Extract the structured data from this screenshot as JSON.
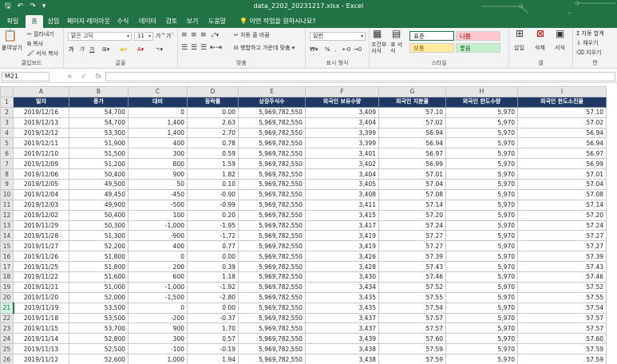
{
  "window": {
    "title": "data_2202_20231217.xlsx  -  Excel"
  },
  "qat": {
    "save_icon": "save-icon",
    "undo_icon": "undo-icon",
    "redo_icon": "redo-icon"
  },
  "tabs": [
    {
      "label": "파일"
    },
    {
      "label": "홈"
    },
    {
      "label": "삽입"
    },
    {
      "label": "페이지 레이아웃"
    },
    {
      "label": "수식"
    },
    {
      "label": "데이터"
    },
    {
      "label": "검토"
    },
    {
      "label": "보기"
    },
    {
      "label": "도움말"
    }
  ],
  "active_tab": "홈",
  "tell_me": "어떤 작업을 원하시나요?",
  "ribbon": {
    "clipboard": {
      "paste": "붙여넣기",
      "cut": "잘라내기",
      "copy": "복사",
      "format_painter": "서식 복사",
      "label": "클립보드"
    },
    "font": {
      "name": "맑은 고딕",
      "size": "11",
      "bold": "가",
      "italic": "가",
      "underline": "가",
      "grow": "가^",
      "shrink": "가ˇ",
      "label": "글꼴"
    },
    "align": {
      "wrap": "자동 줄 바꿈",
      "merge": "병합하고 가운데 맞춤",
      "label": "맞춤"
    },
    "number": {
      "format": "일반",
      "percent": "%",
      "comma": ",",
      "label": "표시 형식"
    },
    "styles": {
      "cond": "조건부 서식",
      "table": "표 서식",
      "normal": "표준",
      "bad": "나쁨",
      "good_text": "보통",
      "neutral": "좋음",
      "label": "스타일"
    },
    "cells": {
      "insert": "삽입",
      "delete": "삭제",
      "format": "서식",
      "label": "셀"
    },
    "editing": {
      "autosum": "Σ 자동 합계",
      "fill": "채우기",
      "clear": "지우기",
      "label": "편"
    }
  },
  "formula_bar": {
    "name_box": "M21",
    "cancel": "×",
    "enter": "✓",
    "fx": "fx",
    "value": ""
  },
  "sheet": {
    "columns": [
      "A",
      "B",
      "C",
      "D",
      "E",
      "F",
      "G",
      "H",
      "I"
    ],
    "headers": [
      "일자",
      "종가",
      "대비",
      "등락률",
      "상장주식수",
      "외국인 보유수량",
      "외국인 지분율",
      "외국인 한도수량",
      "외국인 한도소진율"
    ],
    "selected_row": 21,
    "rows": [
      [
        "2019/12/16",
        "54,700",
        "0",
        "0.00",
        "5,969,782,550",
        "3,409",
        "57.10",
        "5,970",
        "57.10"
      ],
      [
        "2019/12/13",
        "54,700",
        "1,400",
        "2.63",
        "5,969,782,550",
        "3,404",
        "57.02",
        "5,970",
        "57.02"
      ],
      [
        "2019/12/12",
        "53,300",
        "1,400",
        "2.70",
        "5,969,782,550",
        "3,399",
        "56.94",
        "5,970",
        "56.94"
      ],
      [
        "2019/12/11",
        "51,900",
        "400",
        "0.78",
        "5,969,782,550",
        "3,399",
        "56.94",
        "5,970",
        "56.94"
      ],
      [
        "2019/12/10",
        "51,500",
        "300",
        "0.59",
        "5,969,782,550",
        "3,401",
        "56.97",
        "5,970",
        "56.97"
      ],
      [
        "2019/12/09",
        "51,200",
        "800",
        "1.59",
        "5,969,782,550",
        "3,402",
        "56.99",
        "5,970",
        "56.99"
      ],
      [
        "2019/12/06",
        "50,400",
        "900",
        "1.82",
        "5,969,782,550",
        "3,404",
        "57.01",
        "5,970",
        "57.01"
      ],
      [
        "2019/12/05",
        "49,500",
        "50",
        "0.10",
        "5,969,782,550",
        "3,405",
        "57.04",
        "5,970",
        "57.04"
      ],
      [
        "2019/12/04",
        "49,450",
        "-450",
        "-0.90",
        "5,969,782,550",
        "3,408",
        "57.08",
        "5,970",
        "57.08"
      ],
      [
        "2019/12/03",
        "49,900",
        "-500",
        "-0.99",
        "5,969,782,550",
        "3,411",
        "57.14",
        "5,970",
        "57.14"
      ],
      [
        "2019/12/02",
        "50,400",
        "100",
        "0.20",
        "5,969,782,550",
        "3,415",
        "57.20",
        "5,970",
        "57.20"
      ],
      [
        "2019/11/29",
        "50,300",
        "-1,000",
        "-1.95",
        "5,969,782,550",
        "3,417",
        "57.24",
        "5,970",
        "57.24"
      ],
      [
        "2019/11/28",
        "51,300",
        "-900",
        "-1.72",
        "5,969,782,550",
        "3,419",
        "57.27",
        "5,970",
        "57.27"
      ],
      [
        "2019/11/27",
        "52,200",
        "400",
        "0.77",
        "5,969,782,550",
        "3,419",
        "57.27",
        "5,970",
        "57.27"
      ],
      [
        "2019/11/26",
        "51,800",
        "0",
        "0.00",
        "5,969,782,550",
        "3,426",
        "57.39",
        "5,970",
        "57.39"
      ],
      [
        "2019/11/25",
        "51,800",
        "200",
        "0.39",
        "5,969,782,550",
        "3,428",
        "57.43",
        "5,970",
        "57.43"
      ],
      [
        "2019/11/22",
        "51,600",
        "600",
        "1.18",
        "5,969,782,550",
        "3,430",
        "57.46",
        "5,970",
        "57.46"
      ],
      [
        "2019/11/21",
        "51,000",
        "-1,000",
        "-1.92",
        "5,969,782,550",
        "3,434",
        "57.52",
        "5,970",
        "57.52"
      ],
      [
        "2019/11/20",
        "52,000",
        "-1,500",
        "-2.80",
        "5,969,782,550",
        "3,435",
        "57.55",
        "5,970",
        "57.55"
      ],
      [
        "2019/11/19",
        "53,500",
        "0",
        "0.00",
        "5,969,782,550",
        "3,435",
        "57.54",
        "5,970",
        "57.54"
      ],
      [
        "2019/11/18",
        "53,500",
        "-200",
        "-0.37",
        "5,969,782,550",
        "3,437",
        "57.57",
        "5,970",
        "57.57"
      ],
      [
        "2019/11/15",
        "53,700",
        "900",
        "1.70",
        "5,969,782,550",
        "3,437",
        "57.57",
        "5,970",
        "57.57"
      ],
      [
        "2019/11/14",
        "52,800",
        "300",
        "0.57",
        "5,969,782,550",
        "3,439",
        "57.60",
        "5,970",
        "57.60"
      ],
      [
        "2019/11/13",
        "52,500",
        "-100",
        "-0.19",
        "5,969,782,550",
        "3,438",
        "57.59",
        "5,970",
        "57.59"
      ],
      [
        "2019/11/12",
        "52,600",
        "1,000",
        "1.94",
        "5,969,782,550",
        "3,438",
        "57.59",
        "5,970",
        "57.59"
      ],
      [
        "2019/11/11",
        "51,600",
        "-500",
        "-0.96",
        "5,969,782,550",
        "3,438",
        "57.60",
        "5,970",
        "57.60"
      ]
    ]
  },
  "colors": {
    "brand": "#217346",
    "header_fill": "#1f3864",
    "header_text": "#ffffff",
    "bad_fill": "#ffc7ce",
    "good_fill": "#c6efce",
    "neutral_fill": "#ffeb9c"
  }
}
